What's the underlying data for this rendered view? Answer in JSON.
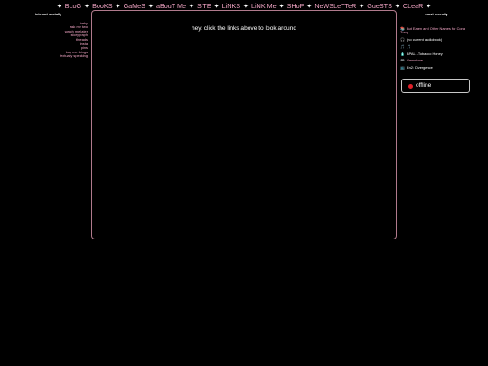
{
  "nav": {
    "items": [
      "BLoG",
      "BooKS",
      "GaMeS",
      "aBouT Me",
      "SiTE",
      "LiNKS",
      "LiNK Me",
      "SHoP",
      "NeWSLeTTeR",
      "GueSTS",
      "CLeaR"
    ],
    "separator": "✦"
  },
  "left": {
    "heading": "interact socially",
    "links": [
      "baby",
      "ask me two",
      "watch me later",
      "storygraph",
      "threads",
      "insta",
      "pins",
      "buy me things",
      "textually speaking"
    ]
  },
  "main": {
    "message": "hey. click the links above to look around"
  },
  "right": {
    "heading": "most recently",
    "book": {
      "icon": "📚",
      "title_line1": "But Eaten and Other Names for Cora",
      "title_line2": "Zong"
    },
    "audiobook": {
      "icon": "🎧",
      "text": "(no current audiobook)"
    },
    "music": {
      "icon": "🎵",
      "text": "🎵"
    },
    "scent": {
      "icon": "🧴",
      "text": "BPAL - Tobacco Honey"
    },
    "game": {
      "icon": "🎮",
      "text": "Gemstone"
    },
    "show": {
      "icon": "📺",
      "text": "En2: Divergence"
    }
  },
  "status": {
    "label": "offline",
    "color": "#e0202a"
  }
}
